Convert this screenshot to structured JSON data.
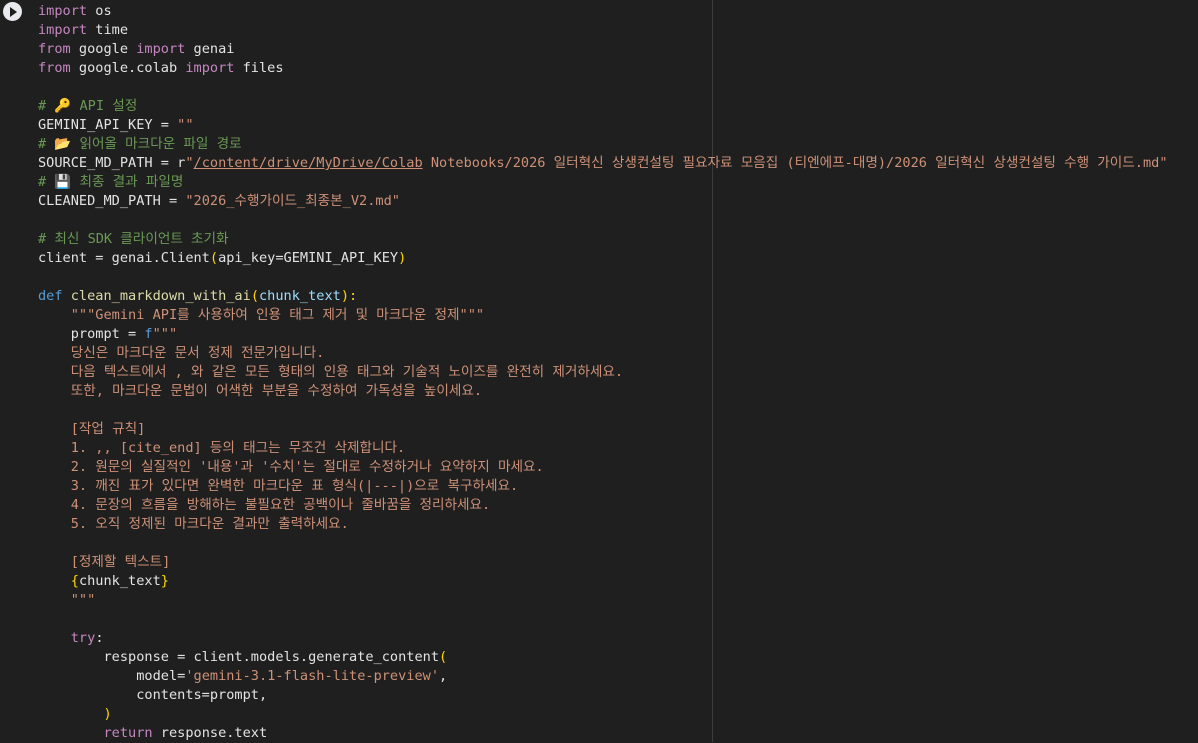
{
  "cell": {
    "run_button_icon": "play-icon",
    "colors": {
      "background": "#1f1f1f",
      "keyword": "#c586c0",
      "string": "#ce9178",
      "comment": "#6a9955",
      "function": "#dcdcaa"
    },
    "code": {
      "l1": {
        "a": "import",
        "b": " os"
      },
      "l2": {
        "a": "import",
        "b": " time"
      },
      "l3": {
        "a": "from",
        "b": " google ",
        "c": "import",
        "d": " genai"
      },
      "l4": {
        "a": "from",
        "b": " google.colab ",
        "c": "import",
        "d": " files"
      },
      "l6": "# 🔑 API 설정",
      "l7": {
        "a": "GEMINI_API_KEY = ",
        "b": "\"\""
      },
      "l8": "# 📂 읽어올 마크다운 파일 경로",
      "l9": {
        "a": "SOURCE_MD_PATH = r",
        "b": "\"",
        "c": "/content/drive/MyDrive/Colab",
        "d": " Notebooks/2026 일터혁신 상생컨설팅 필요자료 모음집 (티엔에프-대명)/2026 일터혁신 상생컨설팅 수행 가이드.md\""
      },
      "l10": "# 💾 최종 결과 파일명",
      "l11": {
        "a": "CLEANED_MD_PATH = ",
        "b": "\"2026_수행가이드_최종본_V2.md\""
      },
      "l13": "# 최신 SDK 클라이언트 초기화",
      "l14": {
        "a": "client = genai.Client",
        "b": "(",
        "c": "api_key=GEMINI_API_KEY",
        "d": ")"
      },
      "l16": {
        "a": "def",
        "b": " ",
        "c": "clean_markdown_with_ai",
        "d": "(",
        "e": "chunk_text",
        "f": "):"
      },
      "l17": "    \"\"\"Gemini API를 사용하여 인용 태그 제거 및 마크다운 정제\"\"\"",
      "l18": {
        "a": "    prompt = ",
        "b": "f",
        "c": "\"\"\""
      },
      "l19": "    당신은 마크다운 문서 정제 전문가입니다.",
      "l20": "    다음 텍스트에서 , 와 같은 모든 형태의 인용 태그와 기술적 노이즈를 완전히 제거하세요.",
      "l21": "    또한, 마크다운 문법이 어색한 부분을 수정하여 가독성을 높이세요.",
      "l23": "    [작업 규칙]",
      "l24": "    1. ,, [cite_end] 등의 태그는 무조건 삭제합니다.",
      "l25": "    2. 원문의 실질적인 '내용'과 '수치'는 절대로 수정하거나 요약하지 마세요.",
      "l26": "    3. 깨진 표가 있다면 완벽한 마크다운 표 형식(|---|)으로 복구하세요.",
      "l27": "    4. 문장의 흐름을 방해하는 불필요한 공백이나 줄바꿈을 정리하세요.",
      "l28": "    5. 오직 정제된 마크다운 결과만 출력하세요.",
      "l30": "    [정제할 텍스트]",
      "l31": {
        "a": "    ",
        "b": "{",
        "c": "chunk_text",
        "d": "}"
      },
      "l32": "    \"\"\"",
      "l34": {
        "a": "    ",
        "b": "try",
        "c": ":"
      },
      "l35": {
        "a": "        response = client.models.generate_content",
        "b": "("
      },
      "l36": {
        "a": "            model=",
        "b": "'gemini-3.1-flash-lite-preview'",
        "c": ","
      },
      "l37": "            contents=prompt,",
      "l38": {
        "a": "        ",
        "b": ")"
      },
      "l39": {
        "a": "        ",
        "b": "return",
        "c": " response.text"
      }
    }
  }
}
